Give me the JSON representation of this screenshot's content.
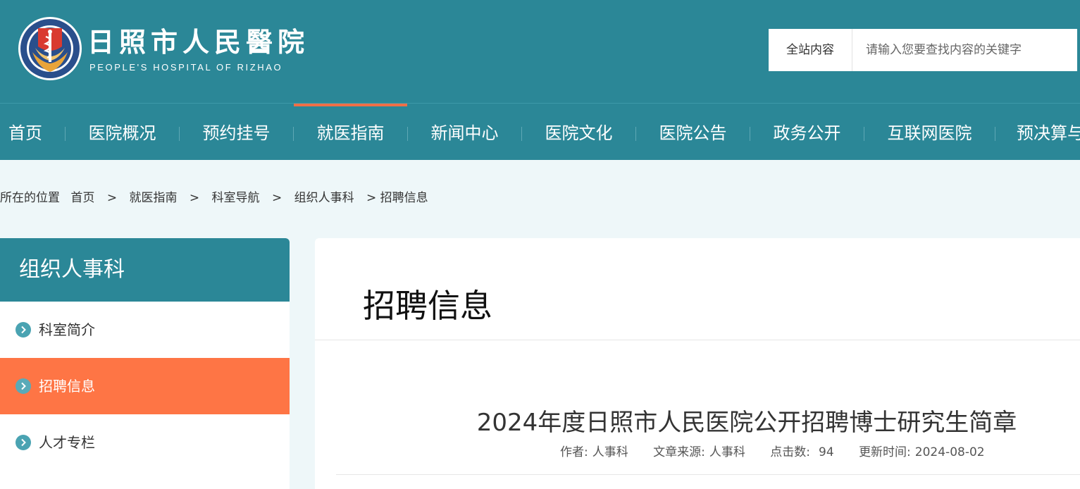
{
  "header": {
    "logo_cn": "日照市人民醫院",
    "logo_en": "PEOPLE'S HOSPITAL OF RIZHAO",
    "logo_emblem_icon": "hospital-emblem-icon",
    "search": {
      "scope": "全站内容",
      "placeholder": "请输入您要查找内容的关键字"
    }
  },
  "nav": {
    "items": [
      {
        "label": "首页"
      },
      {
        "label": "医院概况"
      },
      {
        "label": "预约挂号"
      },
      {
        "label": "就医指南"
      },
      {
        "label": "新闻中心"
      },
      {
        "label": "医院文化"
      },
      {
        "label": "医院公告"
      },
      {
        "label": "政务公开"
      },
      {
        "label": "互联网医院"
      },
      {
        "label": "预决算与"
      }
    ],
    "active_index": 3
  },
  "breadcrumb": {
    "prefix": "所在的位置",
    "items": [
      "首页",
      "就医指南",
      "科室导航",
      "组织人事科"
    ],
    "current": "招聘信息",
    "separator": ">"
  },
  "sidebar": {
    "title": "组织人事科",
    "items": [
      {
        "label": "科室简介"
      },
      {
        "label": "招聘信息"
      },
      {
        "label": "人才专栏"
      }
    ],
    "active_index": 1
  },
  "content": {
    "section_title": "招聘信息",
    "article": {
      "title": "2024年度日照市人民医院公开招聘博士研究生简章",
      "meta": {
        "author_label": "作者:",
        "author": "人事科",
        "source_label": "文章来源:",
        "source": "人事科",
        "clicks_label": "点击数:",
        "clicks": "94",
        "updated_label": "更新时间:",
        "updated": "2024-08-02"
      }
    }
  },
  "colors": {
    "primary": "#2b8797",
    "accent": "#fe7545",
    "nav_active_bar": "#ef6f47",
    "page_bg": "#eef7f9"
  }
}
